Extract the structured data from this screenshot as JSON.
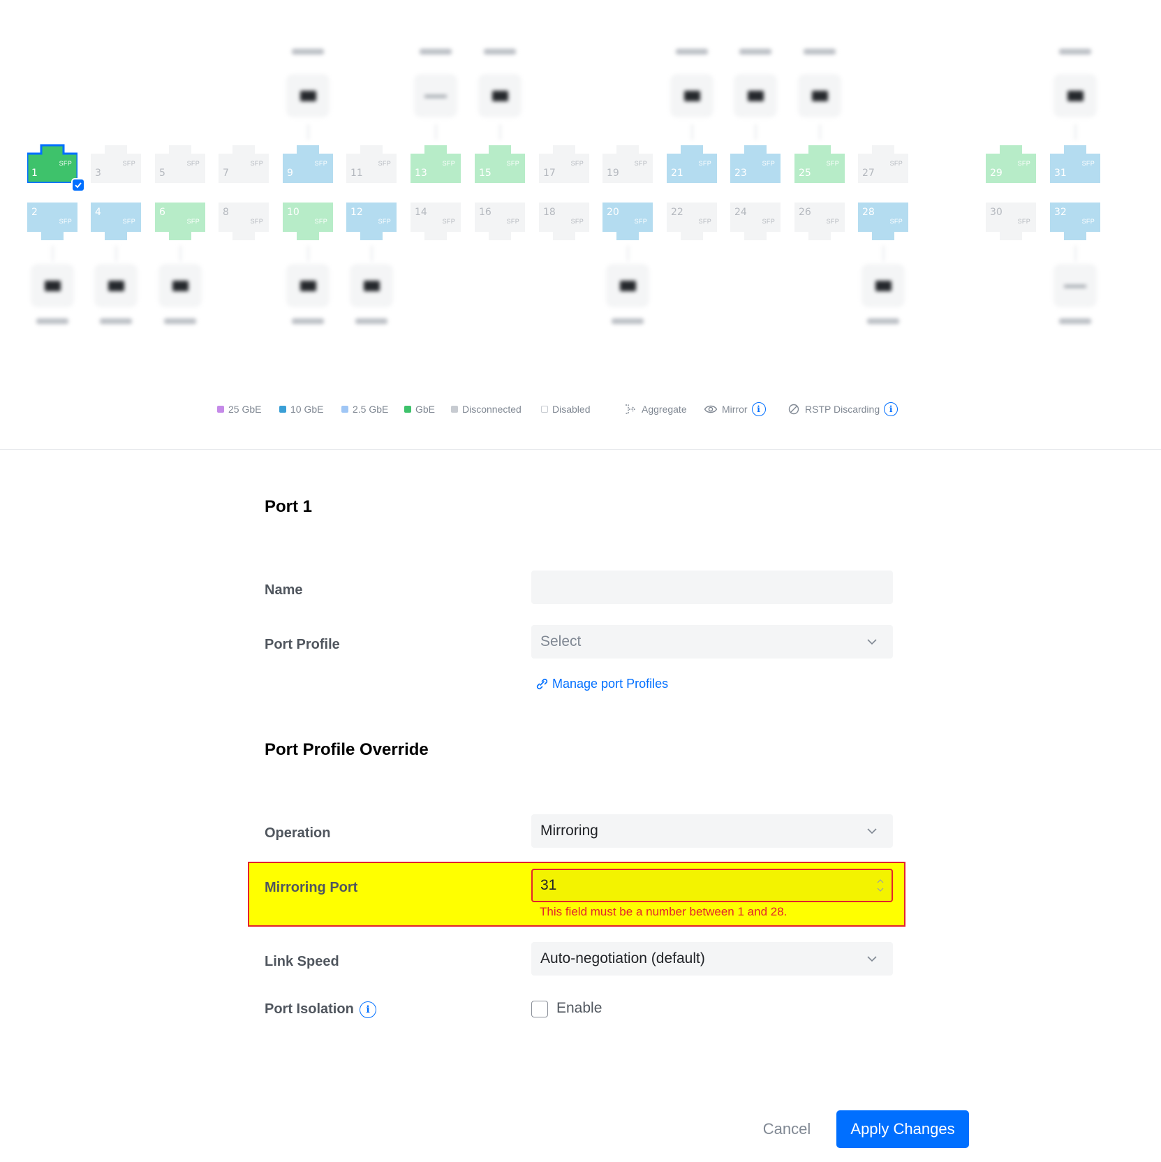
{
  "colors": {
    "gbe": "#3ec26b",
    "gbe_light": "#b7ecc8",
    "ten_gbe": "#b4dcf0",
    "disconnected": "#f3f4f5",
    "selected_border": "#006fff",
    "highlight": "#ffff00",
    "error": "#e3242b",
    "primary": "#006fff"
  },
  "switch": {
    "ports": [
      {
        "num": "1",
        "sfp": "SFP",
        "state": "selected"
      },
      {
        "num": "2",
        "sfp": "SFP",
        "state": "10g"
      },
      {
        "num": "3",
        "sfp": "SFP",
        "state": "disconnected"
      },
      {
        "num": "4",
        "sfp": "SFP",
        "state": "10g"
      },
      {
        "num": "5",
        "sfp": "SFP",
        "state": "disconnected"
      },
      {
        "num": "6",
        "sfp": "SFP",
        "state": "gbe"
      },
      {
        "num": "7",
        "sfp": "SFP",
        "state": "disconnected"
      },
      {
        "num": "8",
        "sfp": "SFP",
        "state": "disconnected"
      },
      {
        "num": "9",
        "sfp": "SFP",
        "state": "10g"
      },
      {
        "num": "10",
        "sfp": "SFP",
        "state": "gbe"
      },
      {
        "num": "11",
        "sfp": "SFP",
        "state": "disconnected"
      },
      {
        "num": "12",
        "sfp": "SFP",
        "state": "10g"
      },
      {
        "num": "13",
        "sfp": "SFP",
        "state": "gbe"
      },
      {
        "num": "14",
        "sfp": "SFP",
        "state": "disconnected"
      },
      {
        "num": "15",
        "sfp": "SFP",
        "state": "gbe"
      },
      {
        "num": "16",
        "sfp": "SFP",
        "state": "disconnected"
      },
      {
        "num": "17",
        "sfp": "SFP",
        "state": "disconnected"
      },
      {
        "num": "18",
        "sfp": "SFP",
        "state": "disconnected"
      },
      {
        "num": "19",
        "sfp": "SFP",
        "state": "disconnected"
      },
      {
        "num": "20",
        "sfp": "SFP",
        "state": "10g"
      },
      {
        "num": "21",
        "sfp": "SFP",
        "state": "10g"
      },
      {
        "num": "22",
        "sfp": "SFP",
        "state": "disconnected"
      },
      {
        "num": "23",
        "sfp": "SFP",
        "state": "10g"
      },
      {
        "num": "24",
        "sfp": "SFP",
        "state": "disconnected"
      },
      {
        "num": "25",
        "sfp": "SFP",
        "state": "gbe"
      },
      {
        "num": "26",
        "sfp": "SFP",
        "state": "disconnected"
      },
      {
        "num": "27",
        "sfp": "SFP",
        "state": "disconnected"
      },
      {
        "num": "28",
        "sfp": "SFP",
        "state": "10g"
      },
      {
        "num": "29",
        "sfp": "SFP",
        "state": "gbe"
      },
      {
        "num": "30",
        "sfp": "SFP",
        "state": "disconnected"
      },
      {
        "num": "31",
        "sfp": "SFP",
        "state": "10g"
      },
      {
        "num": "32",
        "sfp": "SFP",
        "state": "10g"
      }
    ]
  },
  "legend": {
    "items": [
      {
        "label": "25 GbE",
        "color": "#c58ae8"
      },
      {
        "label": "10 GbE",
        "color": "#3a9fd6"
      },
      {
        "label": "2.5 GbE",
        "color": "#9fc6f5"
      },
      {
        "label": "GbE",
        "color": "#3ec26b"
      },
      {
        "label": "Disconnected",
        "color": "#c7cbd1"
      },
      {
        "label": "Disabled",
        "color": "#ffffff"
      }
    ],
    "aggregate": "Aggregate",
    "mirror": "Mirror",
    "rstp": "RSTP Discarding",
    "info_glyph": "i"
  },
  "form": {
    "title": "Port 1",
    "name": {
      "label": "Name",
      "value": ""
    },
    "port_profile": {
      "label": "Port Profile",
      "placeholder": "Select"
    },
    "manage_link": "Manage port Profiles",
    "override_title": "Port Profile Override",
    "operation": {
      "label": "Operation",
      "value": "Mirroring"
    },
    "mirroring_port": {
      "label": "Mirroring Port",
      "value": "31",
      "error": "This field must be a number between 1 and 28."
    },
    "link_speed": {
      "label": "Link Speed",
      "value": "Auto-negotiation (default)"
    },
    "port_isolation": {
      "label": "Port Isolation",
      "checkbox_label": "Enable",
      "checked": false
    }
  },
  "actions": {
    "cancel": "Cancel",
    "apply": "Apply Changes"
  }
}
